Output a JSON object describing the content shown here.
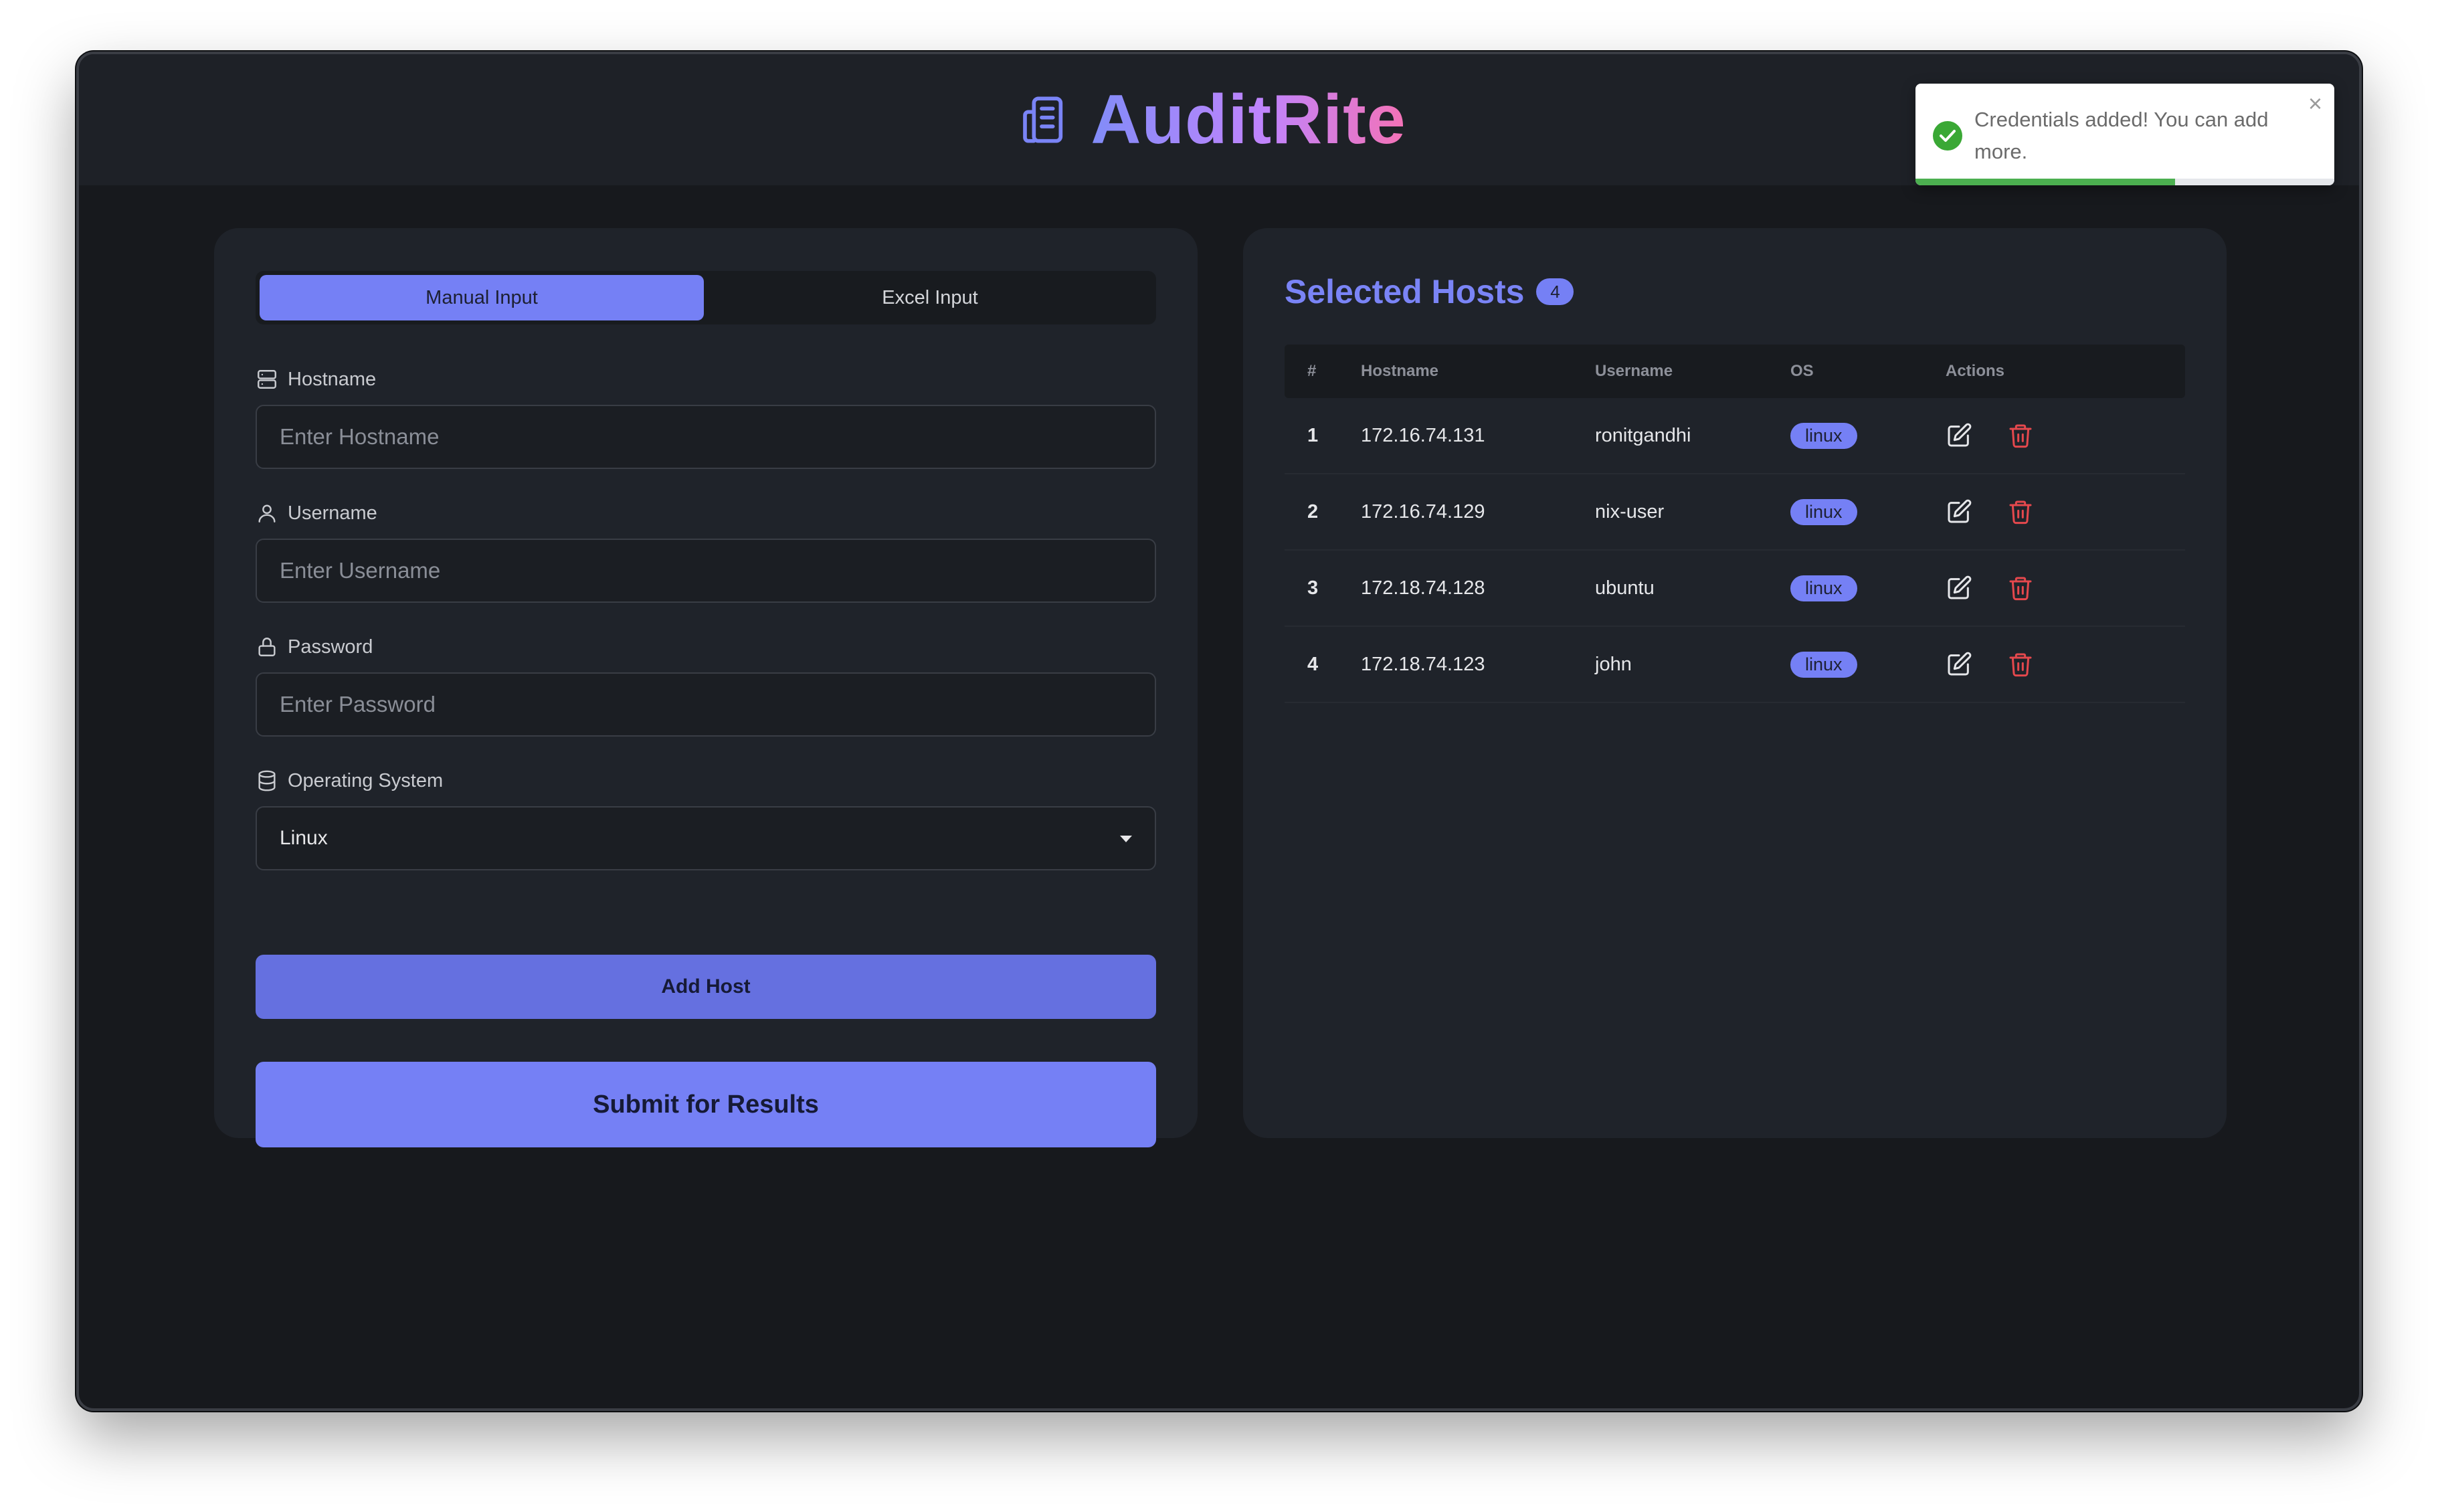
{
  "app": {
    "title": "AuditRite",
    "icon": "document-list-icon"
  },
  "toast": {
    "message": "Credentials added! You can add more.",
    "icon": "check-circle-icon",
    "close_label": "×",
    "progress": 0.62,
    "color": "#4caf50"
  },
  "form": {
    "tabs": [
      {
        "label": "Manual Input",
        "active": true
      },
      {
        "label": "Excel Input",
        "active": false
      }
    ],
    "hostname": {
      "label": "Hostname",
      "placeholder": "Enter Hostname",
      "value": "",
      "icon": "server-icon"
    },
    "username": {
      "label": "Username",
      "placeholder": "Enter Username",
      "value": "",
      "icon": "user-icon"
    },
    "password": {
      "label": "Password",
      "placeholder": "Enter Password",
      "value": "",
      "icon": "lock-icon"
    },
    "os": {
      "label": "Operating System",
      "value": "Linux",
      "icon": "database-icon"
    },
    "add_button": "Add Host",
    "submit_button": "Submit for Results"
  },
  "hosts": {
    "title": "Selected Hosts",
    "count": "4",
    "columns": [
      "#",
      "Hostname",
      "Username",
      "OS",
      "Actions"
    ],
    "rows": [
      {
        "num": "1",
        "hostname": "172.16.74.131",
        "username": "ronitgandhi",
        "os": "linux"
      },
      {
        "num": "2",
        "hostname": "172.16.74.129",
        "username": "nix-user",
        "os": "linux"
      },
      {
        "num": "3",
        "hostname": "172.18.74.128",
        "username": "ubuntu",
        "os": "linux"
      },
      {
        "num": "4",
        "hostname": "172.18.74.123",
        "username": "john",
        "os": "linux"
      }
    ],
    "edit_icon": "edit-icon",
    "delete_icon": "trash-icon"
  },
  "colors": {
    "accent": "#7580f5",
    "danger": "#e5484d",
    "background": "#17191d",
    "panel": "#1f232a"
  }
}
